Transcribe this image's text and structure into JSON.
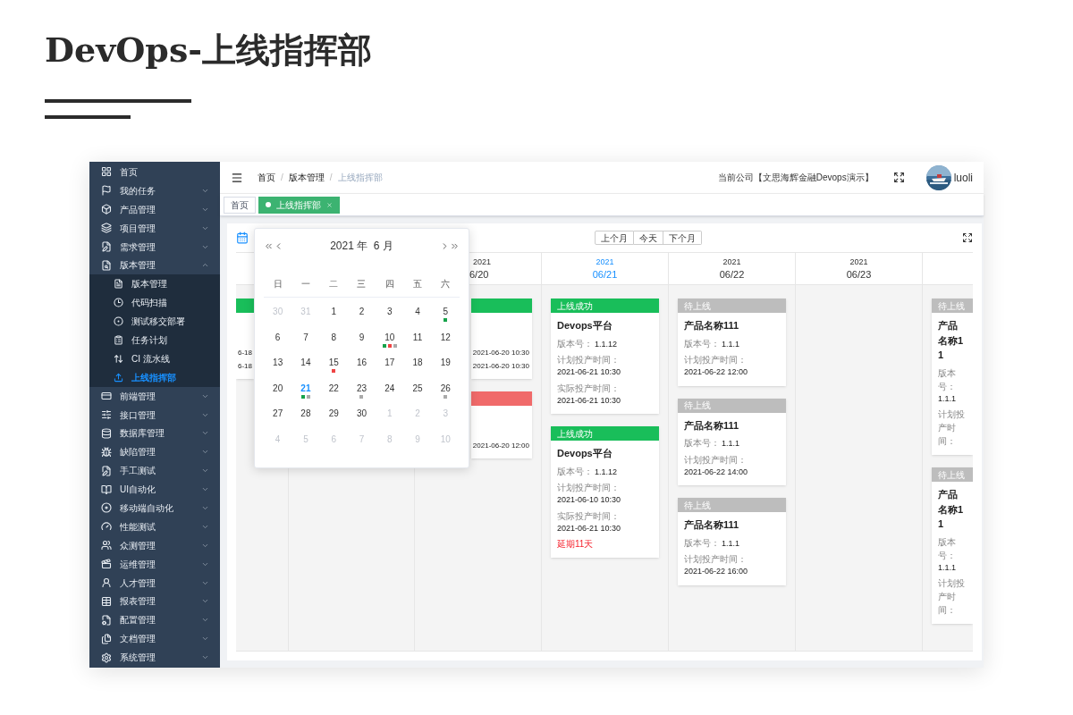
{
  "page_title": "DevOps-上线指挥部",
  "sidebar": {
    "items": [
      {
        "label": "首页",
        "selected": false
      },
      {
        "label": "我的任务",
        "selected": false,
        "expanded": false
      },
      {
        "label": "产品管理",
        "selected": false,
        "expanded": false
      },
      {
        "label": "项目管理",
        "selected": false,
        "expanded": false
      },
      {
        "label": "需求管理",
        "selected": false,
        "expanded": false
      },
      {
        "label": "版本管理",
        "selected": false,
        "expanded": true,
        "children": [
          {
            "label": "版本管理",
            "selected": false
          },
          {
            "label": "代码扫描",
            "selected": false
          },
          {
            "label": "测试移交部署",
            "selected": false
          },
          {
            "label": "任务计划",
            "selected": false
          },
          {
            "label": "CI 流水线",
            "selected": false
          },
          {
            "label": "上线指挥部",
            "selected": true
          }
        ]
      },
      {
        "label": "前端管理",
        "selected": false,
        "expanded": false
      },
      {
        "label": "接口管理",
        "selected": false,
        "expanded": false
      },
      {
        "label": "数据库管理",
        "selected": false,
        "expanded": false
      },
      {
        "label": "缺陷管理",
        "selected": false,
        "expanded": false
      },
      {
        "label": "手工测试",
        "selected": false,
        "expanded": false
      },
      {
        "label": "UI自动化",
        "selected": false,
        "expanded": false
      },
      {
        "label": "移动端自动化",
        "selected": false,
        "expanded": false
      },
      {
        "label": "性能测试",
        "selected": false,
        "expanded": false
      },
      {
        "label": "众测管理",
        "selected": false,
        "expanded": false
      },
      {
        "label": "运维管理",
        "selected": false,
        "expanded": false
      },
      {
        "label": "人才管理",
        "selected": false,
        "expanded": false
      },
      {
        "label": "报表管理",
        "selected": false,
        "expanded": false
      },
      {
        "label": "配置管理",
        "selected": false,
        "expanded": false
      },
      {
        "label": "文档管理",
        "selected": false,
        "expanded": false
      },
      {
        "label": "系统管理",
        "selected": false,
        "expanded": false
      }
    ]
  },
  "header": {
    "breadcrumb": [
      "首页",
      "版本管理",
      "上线指挥部"
    ],
    "separator": "/",
    "company": "当前公司【文思海辉金融Devops演示】",
    "user": "luoli"
  },
  "tabs": [
    {
      "label": "首页",
      "selected": false
    },
    {
      "label": "上线指挥部",
      "selected": true
    }
  ],
  "board": {
    "month_buttons": [
      "上个月",
      "今天",
      "下个月"
    ],
    "columns": [
      {
        "cards": [
          {
            "kind": "success",
            "rows": [
              {
                "value": "6-18"
              },
              {
                "value": "6-18"
              }
            ]
          }
        ]
      },
      {},
      {
        "year": "2021",
        "date": "6/20",
        "selected": false,
        "cards": [
          {
            "kind": "success",
            "rows": [
              {
                "value": "2021-06-20 10:30"
              },
              {
                "value": "2021-06-20 10:30"
              }
            ]
          },
          {
            "kind": "failed",
            "rows": [
              {
                "value": "2021-06-20 12:00"
              }
            ]
          }
        ]
      },
      {
        "year": "2021",
        "date": "06/21",
        "selected": true,
        "cards": [
          {
            "kind": "success",
            "header": "上线成功",
            "title": "Devops平台",
            "rows": [
              {
                "label": "版本号：",
                "value": "1.1.12"
              },
              {
                "label": "计划投产时间：",
                "value": "2021-06-21 10:30"
              },
              {
                "label": "实际投产时间：",
                "value": "2021-06-21 10:30"
              }
            ]
          },
          {
            "kind": "success",
            "header": "上线成功",
            "title": "Devops平台",
            "rows": [
              {
                "label": "版本号：",
                "value": "1.1.12"
              },
              {
                "label": "计划投产时间：",
                "value": "2021-06-10 10:30"
              },
              {
                "label": "实际投产时间：",
                "value": "2021-06-21 10:30"
              }
            ],
            "note": "延期11天"
          }
        ]
      },
      {
        "year": "2021",
        "date": "06/22",
        "selected": false,
        "cards": [
          {
            "kind": "pending",
            "header": "待上线",
            "title": "产品名称111",
            "rows": [
              {
                "label": "版本号：",
                "value": "1.1.1"
              },
              {
                "label": "计划投产时间：",
                "value": "2021-06-22 12:00"
              }
            ]
          },
          {
            "kind": "pending",
            "header": "待上线",
            "title": "产品名称111",
            "rows": [
              {
                "label": "版本号：",
                "value": "1.1.1"
              },
              {
                "label": "计划投产时间：",
                "value": "2021-06-22 14:00"
              }
            ]
          },
          {
            "kind": "pending",
            "header": "待上线",
            "title": "产品名称111",
            "rows": [
              {
                "label": "版本号：",
                "value": "1.1.1"
              },
              {
                "label": "计划投产时间：",
                "value": "2021-06-22 16:00"
              }
            ]
          }
        ]
      },
      {
        "year": "2021",
        "date": "06/23",
        "selected": false
      },
      {
        "cards": [
          {
            "kind": "pending",
            "header": "待上线",
            "title": "产品名称11",
            "rows": [
              {
                "label": "版本号：",
                "value": "1.1.1"
              },
              {
                "label": "计划投产时间："
              }
            ]
          },
          {
            "kind": "pending",
            "header": "待上线",
            "title": "产品名称11",
            "rows": [
              {
                "label": "版本号：",
                "value": "1.1.1"
              },
              {
                "label": "计划投产时间："
              }
            ]
          }
        ]
      }
    ]
  },
  "date_picker": {
    "title": "2021 年  6 月",
    "weekdays": [
      "日",
      "一",
      "二",
      "三",
      "四",
      "五",
      "六"
    ],
    "weeks": [
      [
        {
          "day": "30",
          "outside": true,
          "selected": false
        },
        {
          "day": "31",
          "outside": true,
          "selected": false
        },
        {
          "day": "1",
          "outside": false,
          "selected": false
        },
        {
          "day": "2",
          "outside": false,
          "selected": false
        },
        {
          "day": "3",
          "outside": false,
          "selected": false
        },
        {
          "day": "4",
          "outside": false,
          "selected": false
        },
        {
          "day": "5",
          "outside": false,
          "selected": false,
          "dots": [
            {
              "color": "#16a34a"
            }
          ]
        }
      ],
      [
        {
          "day": "6",
          "outside": false,
          "selected": false
        },
        {
          "day": "7",
          "outside": false,
          "selected": false
        },
        {
          "day": "8",
          "outside": false,
          "selected": false
        },
        {
          "day": "9",
          "outside": false,
          "selected": false
        },
        {
          "day": "10",
          "outside": false,
          "selected": false,
          "dots": [
            {
              "color": "#16a34a"
            },
            {
              "color": "#ef4444"
            },
            {
              "color": "#aaaaaa"
            }
          ]
        },
        {
          "day": "11",
          "outside": false,
          "selected": false
        },
        {
          "day": "12",
          "outside": false,
          "selected": false
        }
      ],
      [
        {
          "day": "13",
          "outside": false,
          "selected": false
        },
        {
          "day": "14",
          "outside": false,
          "selected": false
        },
        {
          "day": "15",
          "outside": false,
          "selected": false,
          "dots": [
            {
              "color": "#ef4444"
            }
          ]
        },
        {
          "day": "16",
          "outside": false,
          "selected": false
        },
        {
          "day": "17",
          "outside": false,
          "selected": false
        },
        {
          "day": "18",
          "outside": false,
          "selected": false
        },
        {
          "day": "19",
          "outside": false,
          "selected": false
        }
      ],
      [
        {
          "day": "20",
          "outside": false,
          "selected": false
        },
        {
          "day": "21",
          "outside": false,
          "selected": true,
          "dots": [
            {
              "color": "#16a34a"
            },
            {
              "color": "#aaaaaa"
            }
          ]
        },
        {
          "day": "22",
          "outside": false,
          "selected": false
        },
        {
          "day": "23",
          "outside": false,
          "selected": false,
          "dots": [
            {
              "color": "#aaaaaa"
            }
          ]
        },
        {
          "day": "24",
          "outside": false,
          "selected": false
        },
        {
          "day": "25",
          "outside": false,
          "selected": false
        },
        {
          "day": "26",
          "outside": false,
          "selected": false,
          "dots": [
            {
              "color": "#aaaaaa"
            }
          ]
        }
      ],
      [
        {
          "day": "27",
          "outside": false,
          "selected": false
        },
        {
          "day": "28",
          "outside": false,
          "selected": false
        },
        {
          "day": "29",
          "outside": false,
          "selected": false
        },
        {
          "day": "30",
          "outside": false,
          "selected": false
        },
        {
          "day": "1",
          "outside": true,
          "selected": false
        },
        {
          "day": "2",
          "outside": true,
          "selected": false
        },
        {
          "day": "3",
          "outside": true,
          "selected": false
        }
      ],
      [
        {
          "day": "4",
          "outside": true,
          "selected": false
        },
        {
          "day": "5",
          "outside": true,
          "selected": false
        },
        {
          "day": "6",
          "outside": true,
          "selected": false
        },
        {
          "day": "7",
          "outside": true,
          "selected": false
        },
        {
          "day": "8",
          "outside": true,
          "selected": false
        },
        {
          "day": "9",
          "outside": true,
          "selected": false
        },
        {
          "day": "10",
          "outside": true,
          "selected": false
        }
      ]
    ]
  }
}
